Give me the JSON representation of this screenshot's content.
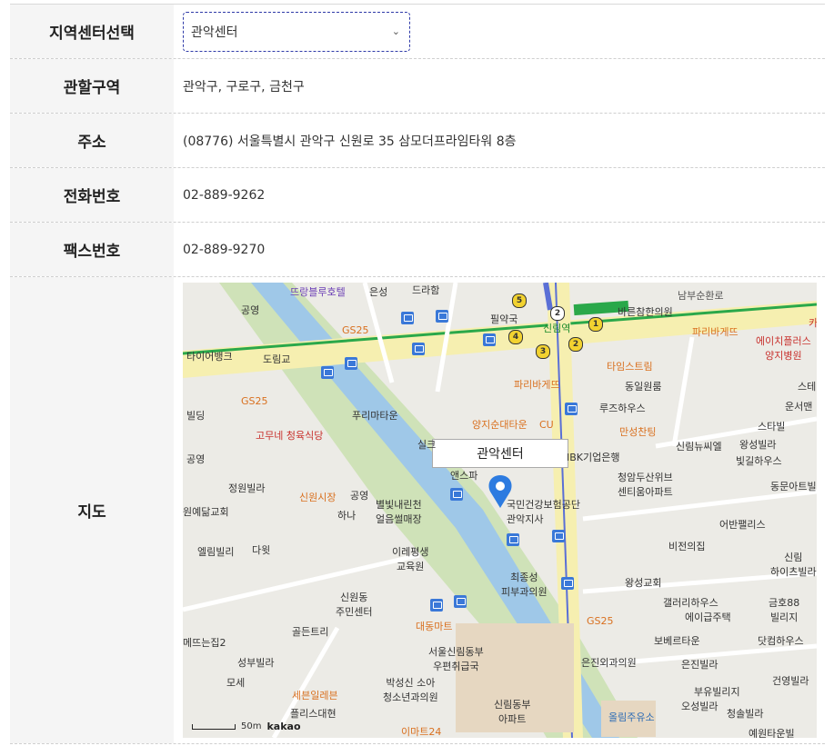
{
  "rows": [
    {
      "label": "지역센터선택",
      "type": "select",
      "value": "관악센터"
    },
    {
      "label": "관할구역",
      "value": "관악구, 구로구, 금천구"
    },
    {
      "label": "주소",
      "value": "(08776) 서울특별시 관악구 신원로 35 삼모더프라임타워 8층"
    },
    {
      "label": "전화번호",
      "value": "02-889-9262"
    },
    {
      "label": "팩스번호",
      "value": "02-889-9270"
    },
    {
      "label": "지도",
      "type": "map"
    }
  ],
  "map": {
    "marker_label": "관악센터",
    "scale_label": "50m",
    "brand": "kakao",
    "places": {
      "p1": "뜨랑블루호텔",
      "p2": "은성",
      "p3": "드라함",
      "p4": "공영",
      "p5": "GS25",
      "p6": "타이어뱅크",
      "p7": "도림교",
      "p8": "GS25",
      "p9": "빌딩",
      "p10": "푸리마타운",
      "p11": "고무네\n청육식당",
      "p12": "공영",
      "p13": "신원시장",
      "p14": "공영",
      "p15": "정원빌라",
      "p16": "원예닮교회",
      "p17": "하나",
      "p18": "별빛내린천\n얼음썰매장",
      "p19": "엘림빌리",
      "p20": "다윗",
      "p21": "이레평생\n교육원",
      "p22": "신원동\n주민센터",
      "p23": "골든트리",
      "p24": "대동마트",
      "p25": "서울신림동부\n우편취급국",
      "p26": "박성신 소아\n청소년과의원",
      "p27": "세븐일레븐",
      "p28": "플리스대현",
      "p29": "성부빌라",
      "p30": "모세",
      "p31": "메뜨는집2",
      "p32": "이마트24",
      "p33": "신림동부\n아파트",
      "p34": "최종성\n피부과의원",
      "p35": "국민건강보험공단\n관악지사",
      "p36": "앤스파",
      "p37": "실크",
      "p38": "양지순대타운",
      "p39": "CU",
      "p40": "파리바게뜨",
      "p41": "필약국",
      "p42": "신림역",
      "p43": "바른참한의원",
      "p44": "타임스트림",
      "p45": "동일원룸",
      "p46": "루즈하우스",
      "p47": "만성찬팅",
      "p48": "IBK기업은행",
      "p49": "청암두산위브\n센티움아파트",
      "p50": "신림뉴씨엘",
      "p51": "왕성빌라",
      "p52": "빛길하우스",
      "p53": "동문아트빌",
      "p54": "스타빌",
      "p55": "운서맨",
      "p56": "스테",
      "p57": "에이치플러스\n양지병원",
      "p58": "파리바게뜨",
      "p59": "남부순환로",
      "p60": "어반팰리스",
      "p61": "비전의집",
      "p62": "신림\n하이츠빌라",
      "p63": "왕성교회",
      "p64": "갤러리하우스",
      "p65": "에이급주택",
      "p66": "금호88\n빌리지",
      "p67": "GS25",
      "p68": "보베르타운",
      "p69": "은진외과의원",
      "p70": "은진빌라",
      "p71": "닷컴하우스",
      "p72": "건영빌라",
      "p73": "부유빌리지",
      "p74": "오성빌라",
      "p75": "청솔빌라",
      "p76": "올림주유소",
      "p77": "예원타운빌",
      "p78": "카"
    }
  }
}
